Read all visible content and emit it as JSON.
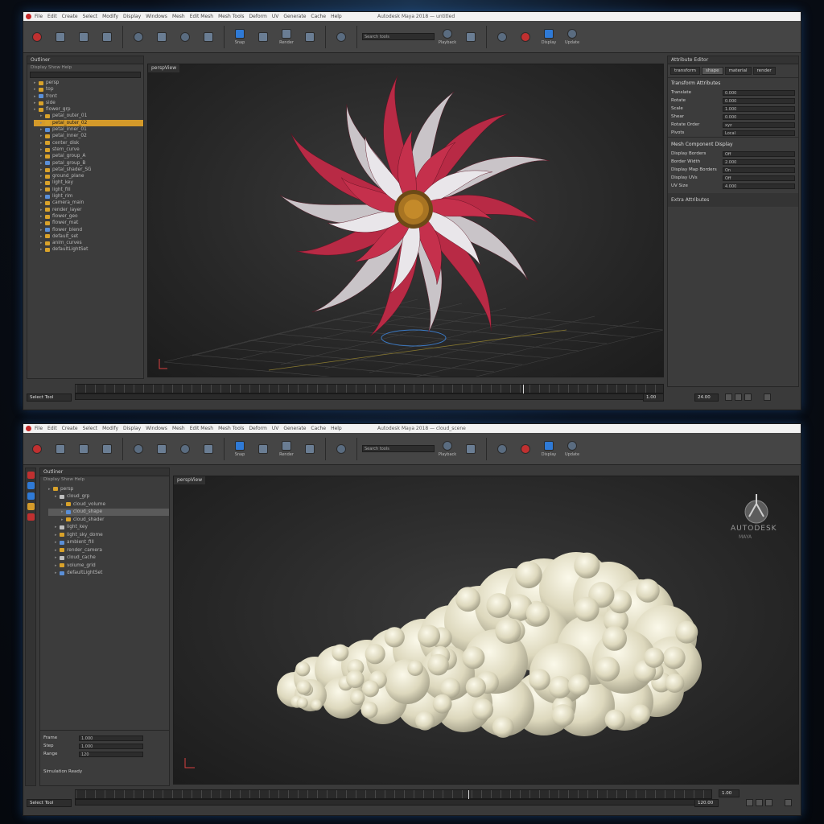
{
  "colors": {
    "accent": "#d49a2a",
    "selection_blue": "#2f7ad6",
    "record_red": "#c03030",
    "bg": "#3a3a3a"
  },
  "windows": [
    {
      "menu": [
        "File",
        "Edit",
        "Create",
        "Select",
        "Modify",
        "Display",
        "Windows",
        "Mesh",
        "Edit Mesh",
        "Mesh Tools",
        "Deform",
        "UV",
        "Generate",
        "Cache",
        "Help"
      ],
      "title": "Autodesk Maya 2018 — untitled",
      "toolbar_field": "Search tools",
      "toolbar_labels": [
        "Snap",
        "Render",
        "Playback",
        "Display",
        "Update"
      ],
      "outliner_tab": "Outliner",
      "outliner_header": "Display Show Help",
      "outliner_rows": [
        "persp",
        "top",
        "front",
        "side",
        "flower_grp",
        "petal_outer_01",
        "petal_outer_02",
        "petal_inner_01",
        "petal_inner_02",
        "center_disk",
        "stem_curve",
        "petal_group_A",
        "petal_group_B",
        "petal_shader_SG",
        "ground_plane",
        "light_key",
        "light_fill",
        "light_rim",
        "camera_main",
        "render_layer",
        "flower_geo",
        "flower_mat",
        "flower_blend",
        "default_set",
        "anim_curves",
        "defaultLightSet"
      ],
      "viewport_tab": "perspView",
      "attr_tabs": [
        "transform",
        "shape",
        "material",
        "render"
      ],
      "attr_section": "Transform Attributes",
      "attr_rows": [
        {
          "label": "Translate",
          "value": "0.000"
        },
        {
          "label": "Rotate",
          "value": "0.000"
        },
        {
          "label": "Scale",
          "value": "1.000"
        },
        {
          "label": "Shear",
          "value": "0.000"
        },
        {
          "label": "Rotate Order",
          "value": "xyz"
        },
        {
          "label": "Pivots",
          "value": "Local"
        }
      ],
      "attr_section2": "Mesh Component Display",
      "attr_rows2": [
        {
          "label": "Display Borders",
          "value": "Off"
        },
        {
          "label": "Border Width",
          "value": "2.000"
        },
        {
          "label": "Display Map Borders",
          "value": "On"
        },
        {
          "label": "Display UVs",
          "value": "Off"
        },
        {
          "label": "UV Size",
          "value": "4.000"
        }
      ],
      "attr_footer": "Extra Attributes",
      "status_left": "Select Tool",
      "status_mid": "1.00",
      "status_right": "24.00"
    },
    {
      "menu": [
        "File",
        "Edit",
        "Create",
        "Select",
        "Modify",
        "Display",
        "Windows",
        "Mesh",
        "Edit Mesh",
        "Mesh Tools",
        "Deform",
        "UV",
        "Generate",
        "Cache",
        "Help"
      ],
      "title": "Autodesk Maya 2018 — cloud_scene",
      "toolbar_field": "Search tools",
      "toolbar_labels": [
        "Snap",
        "Render",
        "Playback",
        "Display",
        "Update"
      ],
      "outliner_tab": "Outliner",
      "outliner_header": "Display Show Help",
      "outliner_rows": [
        "persp",
        "cloud_grp",
        "cloud_volume",
        "cloud_shape",
        "cloud_shader",
        "light_key",
        "light_sky_dome",
        "ambient_fill",
        "render_camera",
        "cloud_cache",
        "volume_grid",
        "defaultLightSet"
      ],
      "viewport_tab": "perspView",
      "logo_text": "AUTODESK",
      "logo_sub": "MAYA",
      "bottom_fields": [
        {
          "label": "Frame",
          "value": "1.000"
        },
        {
          "label": "Step",
          "value": "1.000"
        },
        {
          "label": "Range",
          "value": "120"
        }
      ],
      "bottom_note": "Simulation Ready",
      "status_left": "Select Tool",
      "status_mid": "1.00",
      "status_right": "120.00"
    }
  ]
}
